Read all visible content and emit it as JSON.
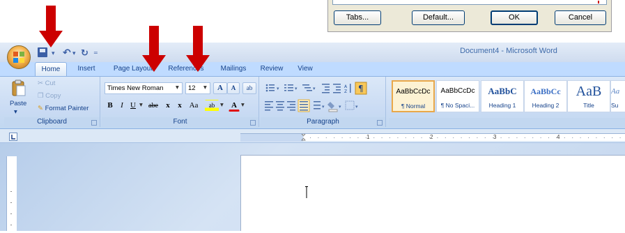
{
  "dialog": {
    "buttons": {
      "tabs": "Tabs...",
      "default": "Default...",
      "ok": "OK",
      "cancel": "Cancel"
    }
  },
  "window": {
    "title": "Document4 - Microsoft Word"
  },
  "tabs": [
    "Home",
    "Insert",
    "Page Layout",
    "References",
    "Mailings",
    "Review",
    "View"
  ],
  "clipboard": {
    "label": "Clipboard",
    "paste": "Paste",
    "cut": "Cut",
    "copy": "Copy",
    "format_painter": "Format Painter"
  },
  "font": {
    "label": "Font",
    "family": "Times New Roman",
    "size": "12",
    "grow": "A",
    "shrink": "A",
    "clear_format": "ab",
    "bold": "B",
    "italic": "I",
    "underline": "U",
    "strike": "abe",
    "subscript": "x",
    "superscript": "x",
    "change_case": "Aa",
    "highlight": "ab",
    "font_color": "A"
  },
  "paragraph": {
    "label": "Paragraph"
  },
  "styles": [
    {
      "sample": "AaBbCcDc",
      "name": "¶ Normal"
    },
    {
      "sample": "AaBbCcDc",
      "name": "¶ No Spaci..."
    },
    {
      "sample": "AaBbC",
      "name": "Heading 1"
    },
    {
      "sample": "AaBbCc",
      "name": "Heading 2"
    },
    {
      "sample": "AaB",
      "name": "Title"
    },
    {
      "sample": "Aa",
      "name": "Su"
    }
  ],
  "ruler": {
    "marks": [
      "1",
      "2",
      "3",
      "4"
    ]
  },
  "colors": {
    "arrow": "#cc0000",
    "ribbon": "#c8daf3",
    "tab_text": "#15428b"
  }
}
